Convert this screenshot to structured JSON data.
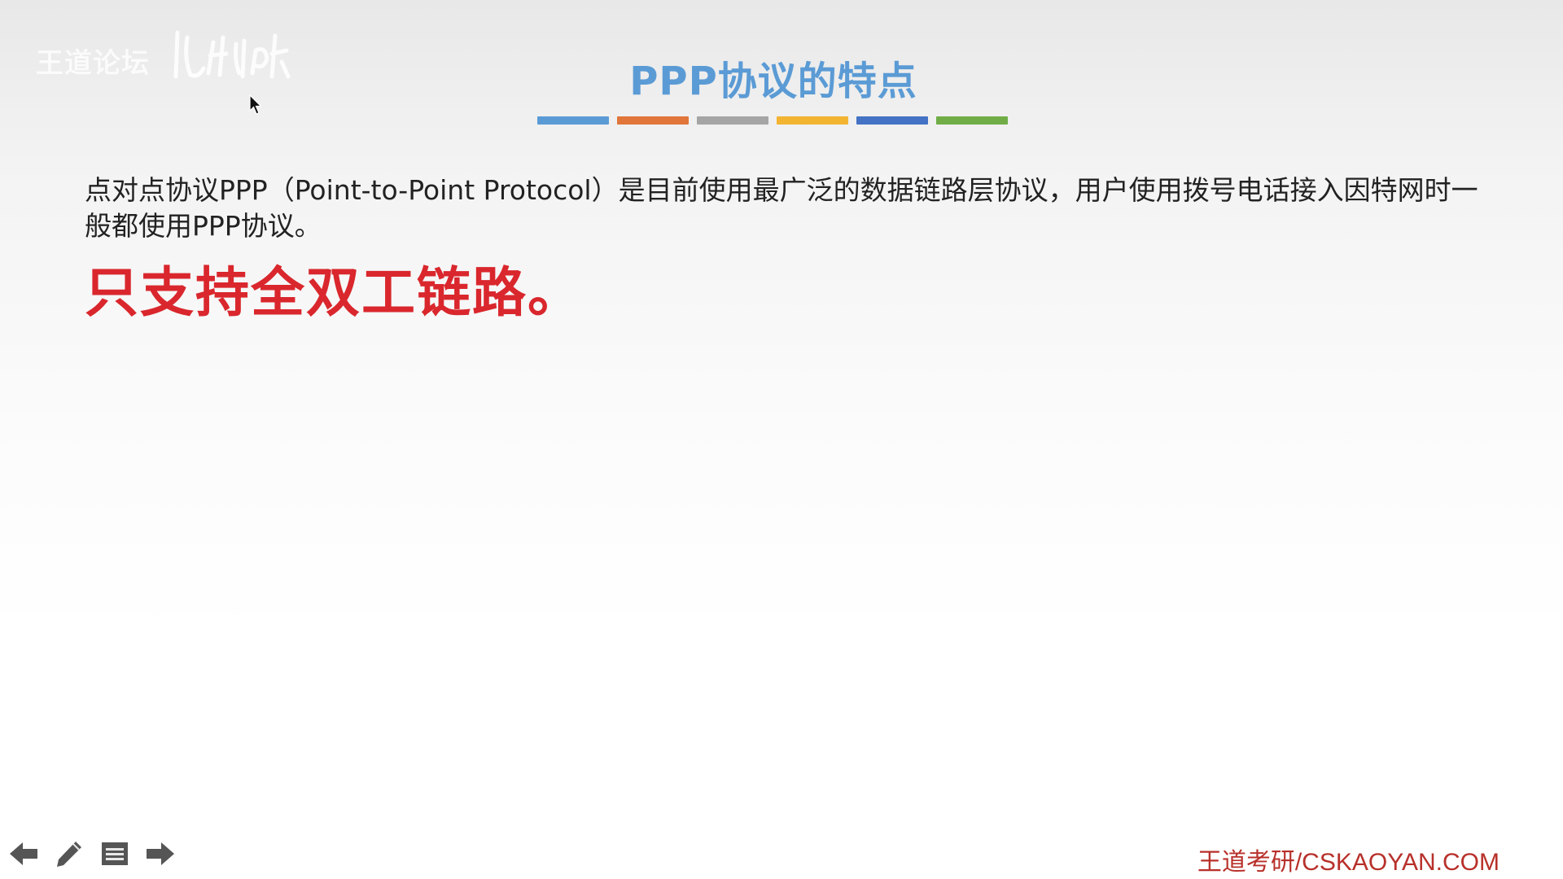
{
  "watermark": {
    "text": "王道论坛"
  },
  "slide": {
    "title": "PPP协议的特点",
    "divider_colors": [
      "#5b9bd5",
      "#e0763a",
      "#a5a5a5",
      "#f2b431",
      "#4472c4",
      "#70ad47"
    ],
    "body": "点对点协议PPP（Point-to-Point Protocol）是目前使用最广泛的数据链路层协议，用户使用拨号电话接入因特网时一般都使用PPP协议。",
    "highlight": "只支持全双工链路。",
    "title_color": "#5b9bd5",
    "highlight_color": "#d9272d"
  },
  "footer": {
    "site_mark": "王道考研/CSKAOYAN.COM"
  },
  "nav": {
    "icons": [
      "arrow-left-icon",
      "pen-icon",
      "menu-icon",
      "arrow-right-icon"
    ]
  }
}
